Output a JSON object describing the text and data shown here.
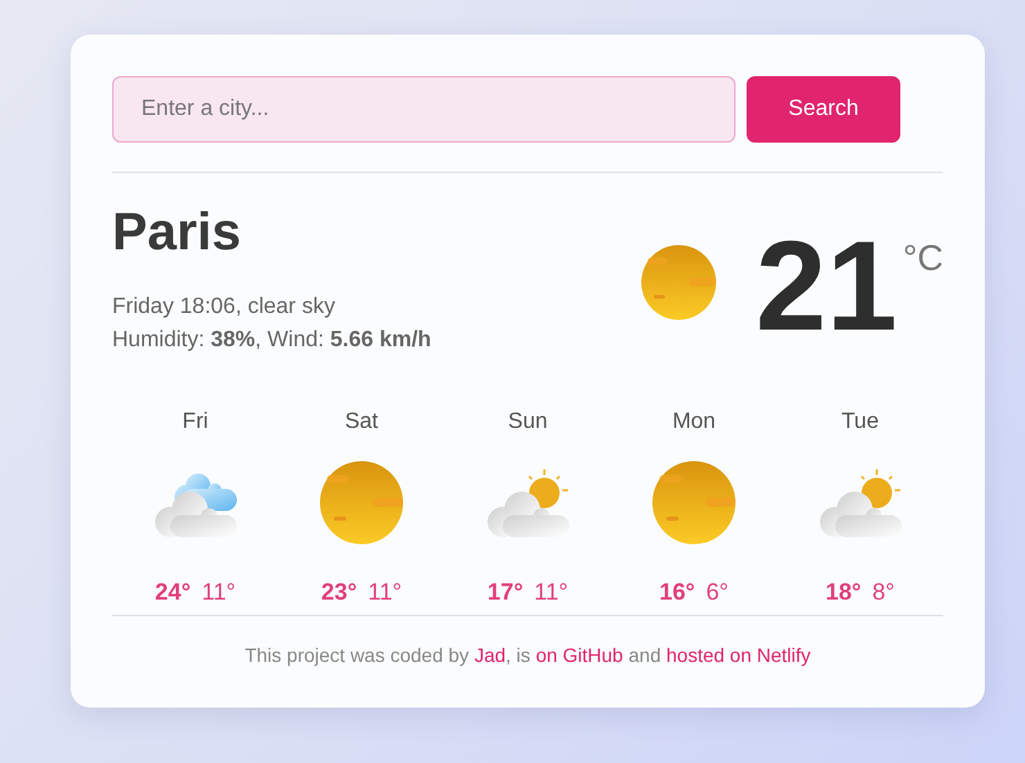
{
  "search": {
    "placeholder": "Enter a city...",
    "button": "Search"
  },
  "current": {
    "city": "Paris",
    "description": "Friday 18:06, clear sky",
    "details": "Humidity: **38%**, Wind: **5.66 km/h**",
    "kind": "sun",
    "temperature": "21",
    "unit": "°C"
  },
  "forecast": [
    {
      "day": "Fri",
      "kind": "clouds",
      "max": "24°",
      "min": "11°"
    },
    {
      "day": "Sat",
      "kind": "sun",
      "max": "23°",
      "min": "11°"
    },
    {
      "day": "Sun",
      "kind": "partly",
      "max": "17°",
      "min": "11°"
    },
    {
      "day": "Mon",
      "kind": "sun",
      "max": "16°",
      "min": "6°"
    },
    {
      "day": "Tue",
      "kind": "partly",
      "max": "18°",
      "min": "8°"
    }
  ],
  "footer": [
    {
      "kind": "text",
      "text": "This project was coded by "
    },
    {
      "kind": "link",
      "text": "Jad"
    },
    {
      "kind": "text",
      "text": ", is "
    },
    {
      "kind": "link",
      "text": "on GitHub"
    },
    {
      "kind": "text",
      "text": " and "
    },
    {
      "kind": "link",
      "text": "hosted on Netlify"
    }
  ]
}
